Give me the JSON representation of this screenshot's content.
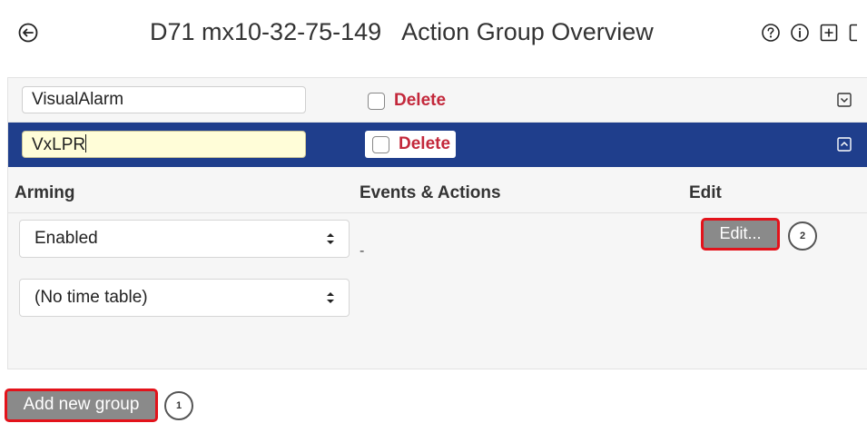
{
  "header": {
    "camera_name": "D71 mx10-32-75-149",
    "page_title": "Action Group Overview",
    "icons": [
      "back-icon",
      "help-icon",
      "info-icon",
      "add-box-icon",
      "more-icon"
    ]
  },
  "groups": [
    {
      "name": "VisualAlarm",
      "delete_label": "Delete",
      "expanded": false,
      "toggle_icon": "chevron-down-box-icon"
    },
    {
      "name": "VxLPR",
      "delete_label": "Delete",
      "expanded": true,
      "toggle_icon": "chevron-up-box-icon"
    }
  ],
  "details": {
    "col_arming": "Arming",
    "col_events": "Events & Actions",
    "col_edit": "Edit",
    "arming_value": "Enabled",
    "time_table_value": "(No time table)",
    "events_value": "-",
    "edit_label": "Edit...",
    "edit_callout": "2"
  },
  "footer": {
    "add_label": "Add new group",
    "add_callout": "1"
  },
  "colors": {
    "selected_row": "#1f3e8c",
    "delete_text": "#c3283b",
    "highlight_border": "#e3131b",
    "button_bg": "#8a8a8a"
  }
}
